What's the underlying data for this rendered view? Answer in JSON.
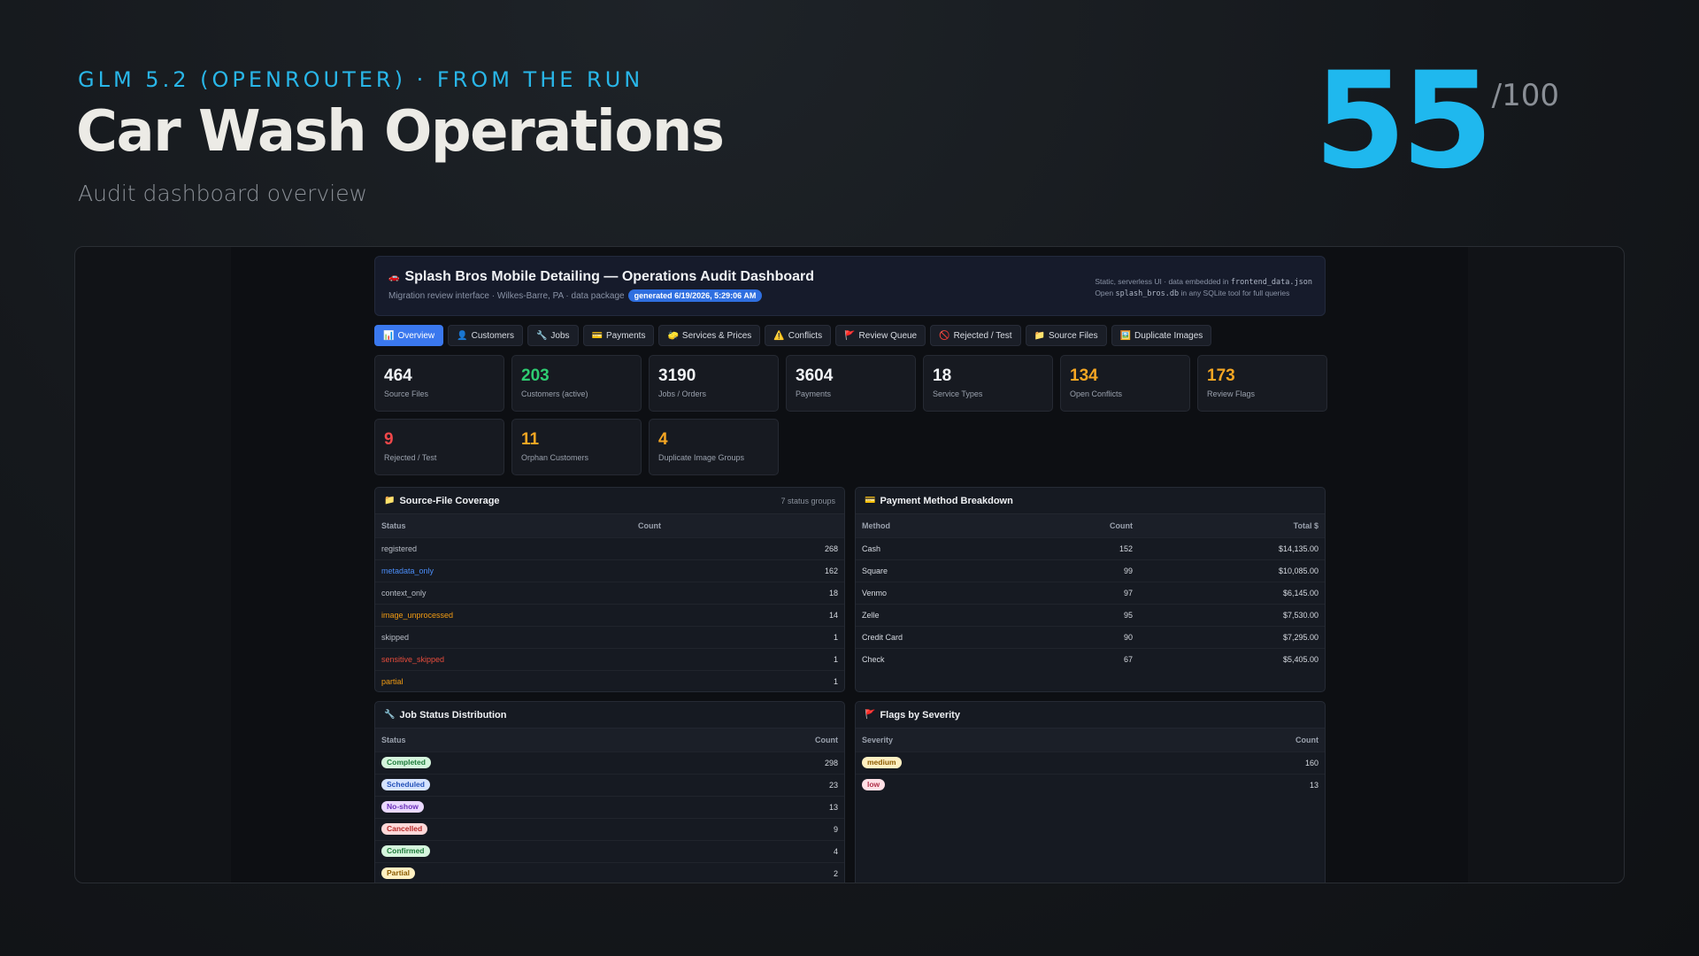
{
  "hero": {
    "eyebrow": "GLM 5.2 (OPENROUTER) · FROM THE RUN",
    "title": "Car Wash Operations",
    "subtitle": "Audit dashboard overview",
    "score": "55",
    "score_max": "/100"
  },
  "app": {
    "title": "Splash Bros Mobile Detailing — Operations Audit Dashboard",
    "meta": "Migration review interface · Wilkes-Barre, PA · data package",
    "generated": "generated 6/19/2026, 5:29:06 AM",
    "note_line1_prefix": "Static, serverless UI · data embedded in",
    "note_line1_file": "frontend_data.json",
    "note_line2_prefix": "Open",
    "note_line2_file": "splash_bros.db",
    "note_line2_suffix": "in any SQLite tool for full queries"
  },
  "tabs": [
    {
      "icon": "📊",
      "label": "Overview"
    },
    {
      "icon": "👤",
      "label": "Customers"
    },
    {
      "icon": "🔧",
      "label": "Jobs"
    },
    {
      "icon": "💳",
      "label": "Payments"
    },
    {
      "icon": "🧽",
      "label": "Services & Prices"
    },
    {
      "icon": "⚠️",
      "label": "Conflicts"
    },
    {
      "icon": "🚩",
      "label": "Review Queue"
    },
    {
      "icon": "🚫",
      "label": "Rejected / Test"
    },
    {
      "icon": "📁",
      "label": "Source Files"
    },
    {
      "icon": "🖼️",
      "label": "Duplicate Images"
    }
  ],
  "cards": [
    {
      "value": "464",
      "label": "Source Files",
      "tone": "default"
    },
    {
      "value": "203",
      "label": "Customers (active)",
      "tone": "green"
    },
    {
      "value": "3190",
      "label": "Jobs / Orders",
      "tone": "default"
    },
    {
      "value": "3604",
      "label": "Payments",
      "tone": "default"
    },
    {
      "value": "18",
      "label": "Service Types",
      "tone": "default"
    },
    {
      "value": "134",
      "label": "Open Conflicts",
      "tone": "orange"
    },
    {
      "value": "173",
      "label": "Review Flags",
      "tone": "orange"
    },
    {
      "value": "9",
      "label": "Rejected / Test",
      "tone": "red"
    },
    {
      "value": "11",
      "label": "Orphan Customers",
      "tone": "orange"
    },
    {
      "value": "4",
      "label": "Duplicate Image Groups",
      "tone": "orange"
    }
  ],
  "coverage": {
    "title": "Source-File Coverage",
    "aside": "7 status groups",
    "columns": [
      "Status",
      "Count"
    ],
    "rows": [
      {
        "status": "registered",
        "count": "268",
        "tone": "muted"
      },
      {
        "status": "metadata_only",
        "count": "162",
        "tone": "blue"
      },
      {
        "status": "context_only",
        "count": "18",
        "tone": "muted"
      },
      {
        "status": "image_unprocessed",
        "count": "14",
        "tone": "amber"
      },
      {
        "status": "skipped",
        "count": "1",
        "tone": "muted"
      },
      {
        "status": "sensitive_skipped",
        "count": "1",
        "tone": "red"
      },
      {
        "status": "partial",
        "count": "1",
        "tone": "amber"
      }
    ]
  },
  "payments": {
    "title": "Payment Method Breakdown",
    "columns": [
      "Method",
      "Count",
      "Total $"
    ],
    "rows": [
      {
        "method": "Cash",
        "count": "152",
        "total": "$14,135.00"
      },
      {
        "method": "Square",
        "count": "99",
        "total": "$10,085.00"
      },
      {
        "method": "Venmo",
        "count": "97",
        "total": "$6,145.00"
      },
      {
        "method": "Zelle",
        "count": "95",
        "total": "$7,530.00"
      },
      {
        "method": "Credit Card",
        "count": "90",
        "total": "$7,295.00"
      },
      {
        "method": "Check",
        "count": "67",
        "total": "$5,405.00"
      }
    ]
  },
  "jobs": {
    "title": "Job Status Distribution",
    "columns": [
      "Status",
      "Count"
    ],
    "rows": [
      {
        "status": "Completed",
        "count": "298",
        "tone": "green"
      },
      {
        "status": "Scheduled",
        "count": "23",
        "tone": "blue"
      },
      {
        "status": "No-show",
        "count": "13",
        "tone": "purple"
      },
      {
        "status": "Cancelled",
        "count": "9",
        "tone": "red"
      },
      {
        "status": "Confirmed",
        "count": "4",
        "tone": "green"
      },
      {
        "status": "Partial",
        "count": "2",
        "tone": "yellow"
      }
    ]
  },
  "flags": {
    "title": "Flags by Severity",
    "columns": [
      "Severity",
      "Count"
    ],
    "rows": [
      {
        "severity": "medium",
        "count": "160",
        "tone": "yellow"
      },
      {
        "severity": "low",
        "count": "13",
        "tone": "pink"
      }
    ]
  },
  "colors": {
    "accent": "#1fb8ee",
    "active_tab": "#3a78ee",
    "green": "#2ecc71",
    "orange": "#f5a623",
    "red": "#f0474a"
  }
}
